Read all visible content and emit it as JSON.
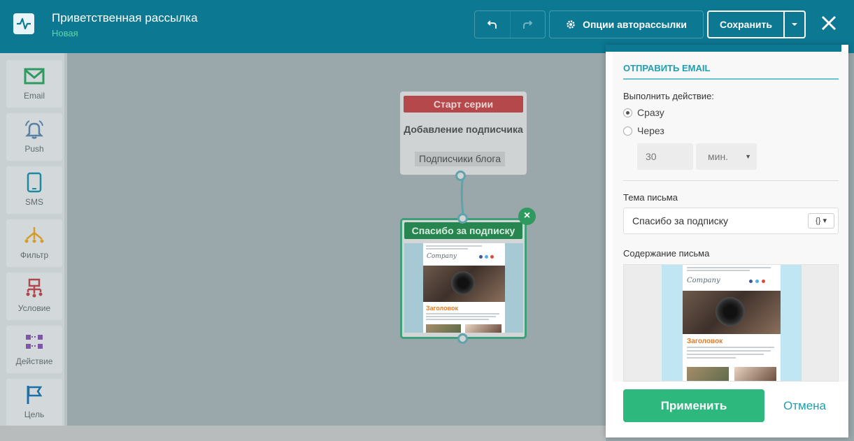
{
  "header": {
    "title": "Приветственная рассылка",
    "status": "Новая",
    "options_label": "Опции авторассылки",
    "save_label": "Сохранить"
  },
  "toolbar": {
    "items": [
      {
        "label": "Email",
        "icon": "envelope-icon",
        "color": "#2e9a5f"
      },
      {
        "label": "Push",
        "icon": "bell-icon",
        "color": "#5a7fa3"
      },
      {
        "label": "SMS",
        "icon": "phone-icon",
        "color": "#1d8aa0"
      },
      {
        "label": "Фильтр",
        "icon": "filter-icon",
        "color": "#d59c2b"
      },
      {
        "label": "Условие",
        "icon": "condition-icon",
        "color": "#b0474c"
      },
      {
        "label": "Действие",
        "icon": "action-icon",
        "color": "#7d56a8"
      },
      {
        "label": "Цель",
        "icon": "flag-icon",
        "color": "#1d6fa8"
      }
    ]
  },
  "canvas": {
    "start_node": {
      "header": "Старт серии",
      "title": "Добавление подписчика",
      "tag": "Подписчики блога"
    },
    "email_node": {
      "header": "Спасибо за подписку"
    }
  },
  "email_preview": {
    "logo": "Company",
    "heading": "Заголовок"
  },
  "panel": {
    "section_title": "ОТПРАВИТЬ EMAIL",
    "action_label": "Выполнить действие:",
    "option_now": "Сразу",
    "option_delay": "Через",
    "delay_value": "30",
    "delay_unit": "мин.",
    "subject_label": "Тема письма",
    "subject_value": "Спасибо за подписку",
    "content_label": "Содержание письма",
    "apply_label": "Применить",
    "cancel_label": "Отмена"
  },
  "colors": {
    "header_bg": "#0d7892",
    "accent": "#1f9eb0",
    "apply": "#2db87d",
    "start_header": "#b5484a",
    "email_header": "#27864f"
  }
}
